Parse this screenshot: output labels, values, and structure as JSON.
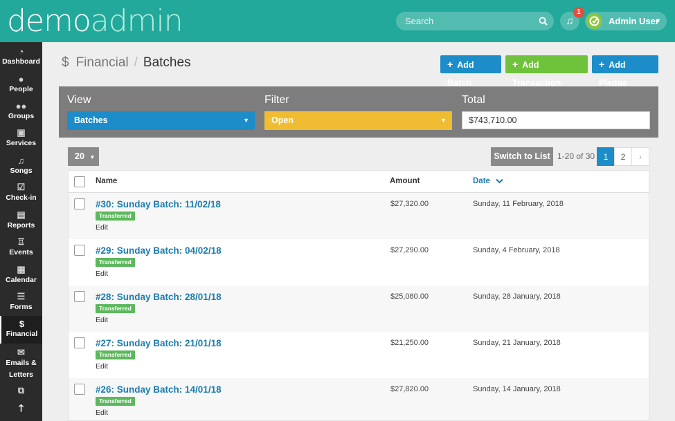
{
  "header": {
    "logo_part1": "demo",
    "logo_part2": "admin",
    "search_placeholder": "Search",
    "notification_count": "1",
    "user_name": "Admin User",
    "brand_color": "#23a99b"
  },
  "sidebar": {
    "items": [
      {
        "label": "Dashboard",
        "icon": "dashboard-icon"
      },
      {
        "label": "People",
        "icon": "person-icon"
      },
      {
        "label": "Groups",
        "icon": "groups-icon"
      },
      {
        "label": "Services",
        "icon": "calendar-icon"
      },
      {
        "label": "Songs",
        "icon": "music-icon"
      },
      {
        "label": "Check-in",
        "icon": "checkbox-icon"
      },
      {
        "label": "Reports",
        "icon": "document-icon"
      },
      {
        "label": "Events",
        "icon": "events-icon"
      },
      {
        "label": "Calendar",
        "icon": "calendar-grid-icon"
      },
      {
        "label": "Forms",
        "icon": "list-icon"
      },
      {
        "label": "Financial",
        "icon": "dollar-icon",
        "active": true
      },
      {
        "label": "Emails &",
        "label2": "Letters",
        "icon": "envelope-icon"
      }
    ]
  },
  "breadcrumb": {
    "section": "Financial",
    "separator": "/",
    "current": "Batches"
  },
  "toolbar": {
    "add_batch": "Add Batch",
    "add_transaction": "Add Transaction",
    "add_pledge": "Add Pledge"
  },
  "filters": {
    "view_label": "View",
    "view_value": "Batches",
    "filter_label": "Filter",
    "filter_value": "Open",
    "total_label": "Total",
    "total_value": "$743,710.00"
  },
  "pager": {
    "per_page": "20",
    "switch_label": "Switch to List",
    "range": "1-20 of 30",
    "pages": [
      "1",
      "2"
    ],
    "next": "›"
  },
  "table": {
    "headers": {
      "name": "Name",
      "amount": "Amount",
      "date": "Date"
    },
    "rows": [
      {
        "name": "#30: Sunday Batch: 11/02/18",
        "status": "Transferred",
        "edit": "Edit",
        "amount": "$27,320.00",
        "date": "Sunday, 11 February, 2018"
      },
      {
        "name": "#29: Sunday Batch: 04/02/18",
        "status": "Transferred",
        "edit": "Edit",
        "amount": "$27,290.00",
        "date": "Sunday, 4 February, 2018"
      },
      {
        "name": "#28: Sunday Batch: 28/01/18",
        "status": "Transferred",
        "edit": "Edit",
        "amount": "$25,080.00",
        "date": "Sunday, 28 January, 2018"
      },
      {
        "name": "#27: Sunday Batch: 21/01/18",
        "status": "Transferred",
        "edit": "Edit",
        "amount": "$21,250.00",
        "date": "Sunday, 21 January, 2018"
      },
      {
        "name": "#26: Sunday Batch: 14/01/18",
        "status": "Transferred",
        "edit": "Edit",
        "amount": "$27,820.00",
        "date": "Sunday, 14 January, 2018"
      }
    ]
  }
}
